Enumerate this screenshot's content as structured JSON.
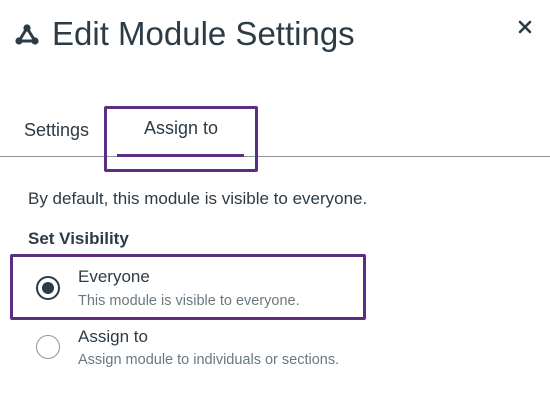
{
  "header": {
    "title": "Edit Module Settings",
    "icon": "module-icon",
    "close_icon": "close-icon"
  },
  "tabs": [
    {
      "label": "Settings",
      "selected": false
    },
    {
      "label": "Assign to",
      "selected": true
    }
  ],
  "assign": {
    "description": "By default, this module is visible to everyone.",
    "section_label": "Set Visibility",
    "options": [
      {
        "title": "Everyone",
        "subtitle": "This module is visible to everyone.",
        "selected": true
      },
      {
        "title": "Assign to",
        "subtitle": "Assign module to individuals or sections.",
        "selected": false
      }
    ]
  },
  "colors": {
    "highlight": "#5b2e82",
    "text": "#2d3b45",
    "subtext": "#6b7780",
    "divider": "#8b969e"
  }
}
